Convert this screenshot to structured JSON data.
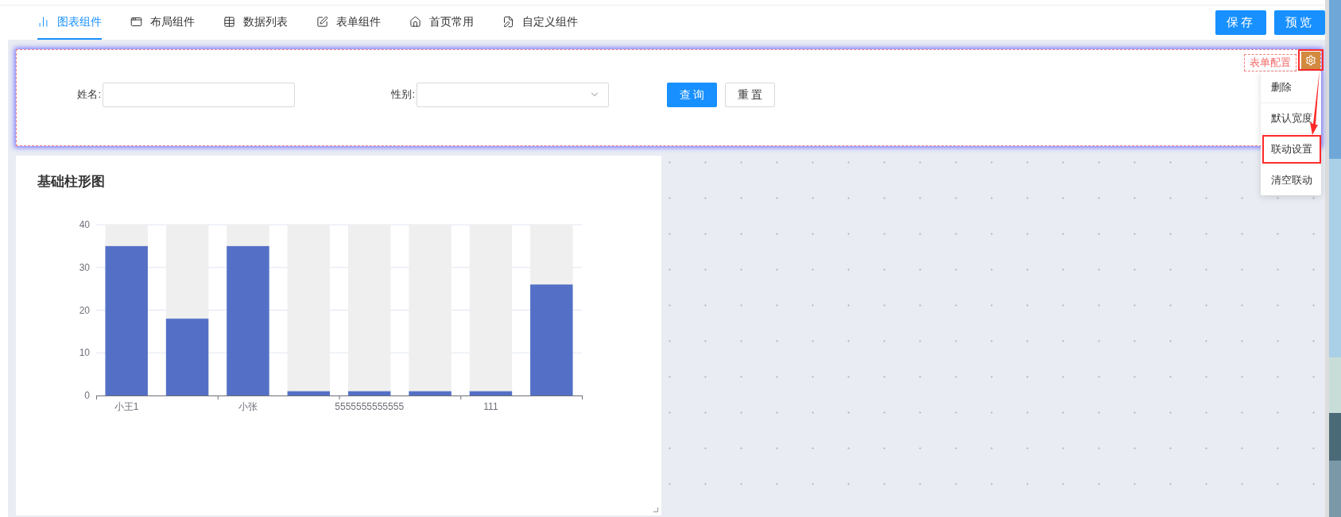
{
  "tabs": [
    {
      "label": "图表组件",
      "selected": true
    },
    {
      "label": "布局组件",
      "selected": false
    },
    {
      "label": "数据列表",
      "selected": false
    },
    {
      "label": "表单组件",
      "selected": false
    },
    {
      "label": "首页常用",
      "selected": false
    },
    {
      "label": "自定义组件",
      "selected": false
    }
  ],
  "actions": [
    "保存",
    "预览"
  ],
  "form": {
    "tag": "表单配置",
    "fields": [
      {
        "kind": "input",
        "label": "姓名:"
      },
      {
        "kind": "select",
        "label": "性别:"
      }
    ],
    "buttons": [
      {
        "label": "查 询",
        "primary": true
      },
      {
        "label": "重 置",
        "primary": false
      }
    ]
  },
  "menu": [
    {
      "label": "删除",
      "highlighted": false
    },
    {
      "label": "默认宽度",
      "highlighted": false
    },
    {
      "label": "联动设置",
      "highlighted": true
    },
    {
      "label": "清空联动",
      "highlighted": false
    }
  ],
  "chart": {
    "title": "基础柱形图",
    "chart_data": {
      "type": "bar",
      "categories": [
        "小王1",
        null,
        "小张",
        null,
        "5555555555555",
        null,
        "111",
        null
      ],
      "series": [
        {
          "color": "#5470c6",
          "values": [
            35,
            18,
            35,
            1,
            1,
            1,
            1,
            26
          ]
        }
      ],
      "grid": true,
      "ylim": [
        0,
        40
      ],
      "yticks": [
        0,
        10,
        20,
        30,
        40
      ]
    }
  }
}
